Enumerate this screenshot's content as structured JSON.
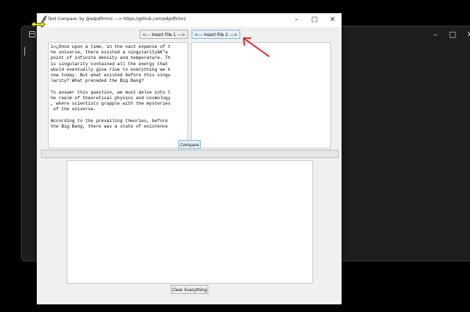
{
  "app": {
    "title": "Text Compare: by @edpdfIrmrz ---> https://github.com/edpdfIrmrz"
  },
  "toolbar": {
    "insert_file_1": "<--- Insert File 1 --->",
    "insert_file_2": "<--- Insert File 2 --->"
  },
  "left_text": {
    "content": "ï»¿Once upon a time, in the vast expanse of t\nhe universe, there existed a singularityâ€\"a\npoint of infinite density and temperature. Th\nis singularity contained all the energy that\nwould eventually give rise to everything we k\nnow today. But what existed before this singu\nlarity? What preceded the Big Bang?\n\nTo answer this question, we must delve into t\nhe realm of theoretical physics and cosmology\n, where scientists grapple with the mysteries\n of the universe.\n\nAccording to the prevailing theories, before\nthe Big Bang, there was a state of existence"
  },
  "right_text": {
    "content": ""
  },
  "result_text": {
    "content": ""
  },
  "actions": {
    "compare": "Compare",
    "clear": "Clear Everything"
  },
  "colors": {
    "arrow": "#e0242a",
    "resize_cursor": "#f5e600"
  },
  "icons": {
    "app_icon": "feather-icon",
    "resize": "resize-horizontal-icon",
    "annotation": "arrow-icon"
  }
}
